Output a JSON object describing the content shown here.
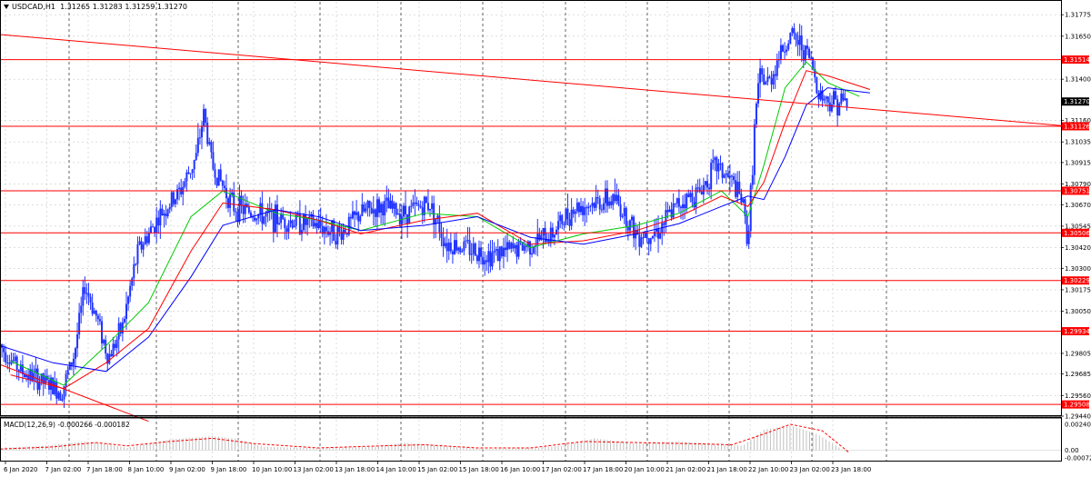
{
  "header": {
    "symbol": "USDCAD,H1",
    "ohlc": "1.31265 1.31283 1.31259 1.31270"
  },
  "indicator_header": {
    "label": "MACD(12,26,9) -0.000266 -0.000182"
  },
  "colors": {
    "background": "#ffffff",
    "grid": "#c8c8c8",
    "candle": "#1f32ff",
    "level_line": "#ff0000",
    "ma_fast": "#00cc00",
    "ma_mid": "#ff0000",
    "ma_slow": "#0000ff",
    "price_tag": "#ff0000",
    "current_tag": "#000000",
    "macd_hist": "#c0c0c0",
    "macd_signal": "#ff0000"
  },
  "chart_data": [
    {
      "type": "candlestick",
      "symbol": "USDCAD",
      "timeframe": "H1",
      "yticks": [
        "1.31775",
        "1.31650",
        "1.31400",
        "1.31160",
        "1.31035",
        "1.30915",
        "1.30790",
        "1.30670",
        "1.30545",
        "1.30420",
        "1.30300",
        "1.30175",
        "1.30050",
        "1.29805",
        "1.29685",
        "1.29560",
        "1.29440"
      ],
      "ylim": [
        1.2944,
        1.3185
      ],
      "xlabels": [
        "6 Jan 2020",
        "7 Jan 02:00",
        "7 Jan 18:00",
        "8 Jan 10:00",
        "9 Jan 02:00",
        "9 Jan 18:00",
        "10 Jan 10:00",
        "13 Jan 02:00",
        "13 Jan 18:00",
        "14 Jan 10:00",
        "15 Jan 02:00",
        "15 Jan 18:00",
        "16 Jan 10:00",
        "17 Jan 02:00",
        "17 Jan 18:00",
        "20 Jan 10:00",
        "21 Jan 02:00",
        "21 Jan 18:00",
        "22 Jan 10:00",
        "23 Jan 02:00",
        "23 Jan 18:00"
      ],
      "horizontal_levels": [
        "1.31514",
        "1.31126",
        "1.30751",
        "1.30506",
        "1.30229",
        "1.29934",
        "1.29508"
      ],
      "current_price": "1.31270",
      "trendlines": [
        {
          "from": [
            0,
            1.3166
          ],
          "to": [
            1.0,
            1.3113
          ]
        },
        {
          "from": [
            0,
            1.2974
          ],
          "to": [
            0.14,
            1.2941
          ]
        }
      ],
      "close_path": [
        [
          0.0,
          1.2985
        ],
        [
          0.02,
          1.297
        ],
        [
          0.04,
          1.2964
        ],
        [
          0.058,
          1.2958
        ],
        [
          0.07,
          1.298
        ],
        [
          0.08,
          1.302
        ],
        [
          0.092,
          1.3
        ],
        [
          0.102,
          1.2978
        ],
        [
          0.115,
          1.2995
        ],
        [
          0.13,
          1.304
        ],
        [
          0.15,
          1.306
        ],
        [
          0.17,
          1.3075
        ],
        [
          0.185,
          1.3095
        ],
        [
          0.192,
          1.312
        ],
        [
          0.2,
          1.309
        ],
        [
          0.22,
          1.3066
        ],
        [
          0.25,
          1.306
        ],
        [
          0.27,
          1.3058
        ],
        [
          0.3,
          1.3055
        ],
        [
          0.32,
          1.305
        ],
        [
          0.34,
          1.3062
        ],
        [
          0.36,
          1.3066
        ],
        [
          0.38,
          1.3062
        ],
        [
          0.405,
          1.3068
        ],
        [
          0.42,
          1.3045
        ],
        [
          0.44,
          1.3042
        ],
        [
          0.46,
          1.3038
        ],
        [
          0.48,
          1.304
        ],
        [
          0.5,
          1.3044
        ],
        [
          0.52,
          1.305
        ],
        [
          0.54,
          1.3065
        ],
        [
          0.56,
          1.3068
        ],
        [
          0.58,
          1.307
        ],
        [
          0.6,
          1.305
        ],
        [
          0.62,
          1.3052
        ],
        [
          0.64,
          1.3068
        ],
        [
          0.66,
          1.3075
        ],
        [
          0.675,
          1.309
        ],
        [
          0.69,
          1.308
        ],
        [
          0.7,
          1.3068
        ],
        [
          0.705,
          1.3045
        ],
        [
          0.712,
          1.312
        ],
        [
          0.716,
          1.314
        ],
        [
          0.725,
          1.3138
        ],
        [
          0.735,
          1.3155
        ],
        [
          0.745,
          1.3165
        ],
        [
          0.755,
          1.316
        ],
        [
          0.765,
          1.315
        ],
        [
          0.77,
          1.3135
        ],
        [
          0.778,
          1.3128
        ],
        [
          0.79,
          1.3127
        ],
        [
          0.8,
          1.3127
        ]
      ],
      "moving_averages": [
        {
          "name": "",
          "color": "#00cc00",
          "path": [
            [
              0.01,
              1.2976
            ],
            [
              0.06,
              1.2962
            ],
            [
              0.1,
              1.2985
            ],
            [
              0.14,
              1.301
            ],
            [
              0.18,
              1.306
            ],
            [
              0.21,
              1.3075
            ],
            [
              0.26,
              1.3062
            ],
            [
              0.3,
              1.3058
            ],
            [
              0.34,
              1.3052
            ],
            [
              0.4,
              1.3062
            ],
            [
              0.45,
              1.306
            ],
            [
              0.5,
              1.3042
            ],
            [
              0.55,
              1.305
            ],
            [
              0.6,
              1.3055
            ],
            [
              0.64,
              1.3062
            ],
            [
              0.68,
              1.3075
            ],
            [
              0.705,
              1.306
            ],
            [
              0.72,
              1.309
            ],
            [
              0.74,
              1.3135
            ],
            [
              0.76,
              1.315
            ],
            [
              0.78,
              1.3138
            ],
            [
              0.81,
              1.313
            ]
          ]
        },
        {
          "name": "",
          "color": "#ff0000",
          "path": [
            [
              0.01,
              1.2968
            ],
            [
              0.06,
              1.296
            ],
            [
              0.1,
              1.2975
            ],
            [
              0.14,
              1.2995
            ],
            [
              0.18,
              1.304
            ],
            [
              0.21,
              1.3068
            ],
            [
              0.26,
              1.3064
            ],
            [
              0.3,
              1.3058
            ],
            [
              0.34,
              1.305
            ],
            [
              0.4,
              1.3058
            ],
            [
              0.45,
              1.3062
            ],
            [
              0.5,
              1.3044
            ],
            [
              0.55,
              1.3046
            ],
            [
              0.6,
              1.3052
            ],
            [
              0.64,
              1.306
            ],
            [
              0.68,
              1.3072
            ],
            [
              0.705,
              1.3066
            ],
            [
              0.72,
              1.308
            ],
            [
              0.74,
              1.3115
            ],
            [
              0.76,
              1.3145
            ],
            [
              0.78,
              1.3142
            ],
            [
              0.82,
              1.3134
            ]
          ]
        },
        {
          "name": "",
          "color": "#0000ff",
          "path": [
            [
              0.0,
              1.2985
            ],
            [
              0.05,
              1.2975
            ],
            [
              0.1,
              1.297
            ],
            [
              0.14,
              1.299
            ],
            [
              0.18,
              1.3025
            ],
            [
              0.21,
              1.3055
            ],
            [
              0.26,
              1.3064
            ],
            [
              0.3,
              1.306
            ],
            [
              0.34,
              1.3052
            ],
            [
              0.4,
              1.3055
            ],
            [
              0.45,
              1.306
            ],
            [
              0.5,
              1.3048
            ],
            [
              0.55,
              1.3044
            ],
            [
              0.6,
              1.305
            ],
            [
              0.64,
              1.3056
            ],
            [
              0.68,
              1.3066
            ],
            [
              0.705,
              1.3072
            ],
            [
              0.72,
              1.307
            ],
            [
              0.74,
              1.3095
            ],
            [
              0.76,
              1.3125
            ],
            [
              0.78,
              1.3135
            ],
            [
              0.82,
              1.3132
            ]
          ]
        }
      ]
    },
    {
      "type": "bar",
      "indicator": "MACD(12,26,9)",
      "main": "-0.000266",
      "signal": "-0.000182",
      "yticks": [
        "0.002401",
        "0.00",
        "-0.000726"
      ],
      "ylim": [
        -0.000726,
        0.002401
      ],
      "hist_envelope": [
        [
          0.0,
          0.0002
        ],
        [
          0.04,
          0.0004
        ],
        [
          0.08,
          0.0008
        ],
        [
          0.1,
          0.0006
        ],
        [
          0.12,
          0.0002
        ],
        [
          0.16,
          0.001
        ],
        [
          0.2,
          0.0013
        ],
        [
          0.22,
          0.0011
        ],
        [
          0.25,
          0.0003
        ],
        [
          0.3,
          0.0002
        ],
        [
          0.35,
          0.0003
        ],
        [
          0.38,
          0.0007
        ],
        [
          0.42,
          0.0004
        ],
        [
          0.46,
          0.0001
        ],
        [
          0.5,
          0.0002
        ],
        [
          0.53,
          0.0004
        ],
        [
          0.56,
          0.0011
        ],
        [
          0.6,
          0.0006
        ],
        [
          0.64,
          0.0008
        ],
        [
          0.7,
          0.0004
        ],
        [
          0.72,
          0.0019
        ],
        [
          0.745,
          0.0023
        ],
        [
          0.77,
          0.0015
        ],
        [
          0.8,
          -0.0003
        ]
      ],
      "signal_path": [
        [
          0.0,
          0.0001
        ],
        [
          0.05,
          0.0003
        ],
        [
          0.09,
          0.0007
        ],
        [
          0.12,
          0.0004
        ],
        [
          0.16,
          0.0008
        ],
        [
          0.2,
          0.0011
        ],
        [
          0.24,
          0.0006
        ],
        [
          0.3,
          0.0002
        ],
        [
          0.36,
          0.0004
        ],
        [
          0.4,
          0.0005
        ],
        [
          0.45,
          0.0002
        ],
        [
          0.5,
          0.0002
        ],
        [
          0.55,
          0.0008
        ],
        [
          0.6,
          0.0007
        ],
        [
          0.65,
          0.0006
        ],
        [
          0.69,
          0.0005
        ],
        [
          0.72,
          0.0015
        ],
        [
          0.745,
          0.0024
        ],
        [
          0.775,
          0.0018
        ],
        [
          0.8,
          -0.0002
        ]
      ]
    }
  ]
}
